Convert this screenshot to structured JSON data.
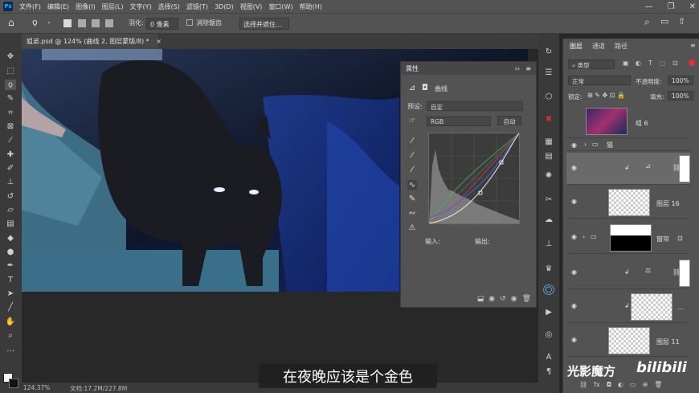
{
  "menu": {
    "items": [
      "文件(F)",
      "编辑(E)",
      "图像(I)",
      "图层(L)",
      "文字(Y)",
      "选择(S)",
      "滤镜(T)",
      "3D(D)",
      "视图(V)",
      "窗口(W)",
      "帮助(H)"
    ],
    "logo": "Ps"
  },
  "options": {
    "feather_label": "羽化:",
    "feather_value": "0 像素",
    "antialias_label": "消除锯齿",
    "select_mask_button": "选择并遮住..."
  },
  "document": {
    "tab_title": "姐弟.psd @ 124% (曲线 2, 图层蒙版/8) *",
    "close": "×"
  },
  "properties": {
    "title": "属性",
    "section": "曲线",
    "preset_label": "预设:",
    "preset_value": "自定",
    "channel_value": "RGB",
    "auto_button": "自动",
    "input_label": "输入:",
    "output_label": "输出:"
  },
  "layers_panel": {
    "tabs": [
      "图层",
      "通道",
      "路径"
    ],
    "filter_kind": "类型",
    "blend_mode": "正常",
    "opacity_label": "不透明度:",
    "opacity_value": "100%",
    "lock_label": "锁定:",
    "fill_label": "填充:",
    "fill_value": "100%",
    "layers": [
      {
        "name": "组 6"
      },
      {
        "name": "猫"
      },
      {
        "name": ""
      },
      {
        "name": "图层 16"
      },
      {
        "name": "窗帘"
      },
      {
        "name": ""
      },
      {
        "name": "..."
      },
      {
        "name": "图层 11"
      }
    ]
  },
  "status": {
    "zoom": "124.37%",
    "doc_size": "文档:17.2M/227.8M"
  },
  "subtitle": "在夜晚应该是个金色",
  "watermark": {
    "text": "光影魔方",
    "logo": "bilibili"
  },
  "colors": {
    "panel_bg": "#535353",
    "dark_bg": "#3a3a3a",
    "canvas_bg": "#282828",
    "accent_blue": "#31a8ff"
  }
}
